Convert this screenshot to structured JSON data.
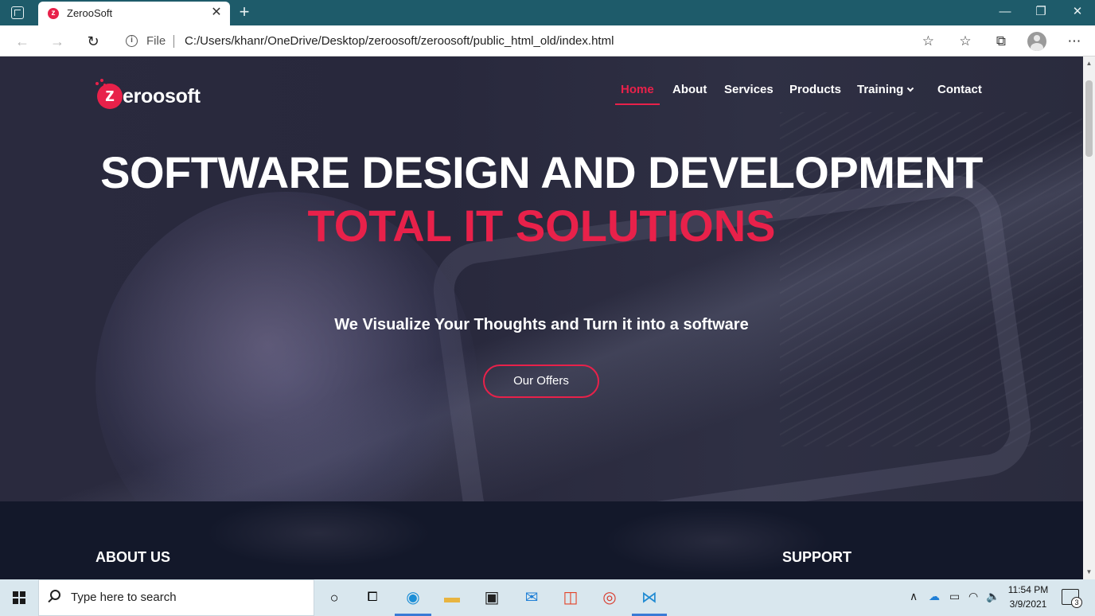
{
  "browser": {
    "tab_title": "ZerooSoft",
    "tab_favicon_letter": "z",
    "file_label": "File",
    "url": "C:/Users/khanr/OneDrive/Desktop/zeroosoft/zeroosoft/public_html_old/index.html"
  },
  "site": {
    "logo_mark": "z",
    "logo_text": "eroosoft",
    "brand_color": "#e8214a",
    "nav": {
      "home": "Home",
      "about": "About",
      "services": "Services",
      "products": "Products",
      "training": "Training",
      "contact": "Contact",
      "active": "Home"
    },
    "hero": {
      "title": "SOFTWARE DESIGN AND DEVELOPMENT",
      "subtitle": "TOTAL IT SOLUTIONS",
      "tagline": "We Visualize Your Thoughts and Turn it into a software",
      "cta": "Our Offers"
    },
    "footer": {
      "about_heading": "ABOUT US",
      "support_heading": "SUPPORT"
    }
  },
  "taskbar": {
    "search_placeholder": "Type here to search",
    "time": "11:54 PM",
    "date": "3/9/2021",
    "notification_count": "3",
    "pinned_apps": [
      "cortana-icon",
      "task-view-icon",
      "edge-icon",
      "file-explorer-icon",
      "store-icon",
      "mail-icon",
      "office-icon",
      "chrome-icon",
      "vscode-icon"
    ]
  }
}
